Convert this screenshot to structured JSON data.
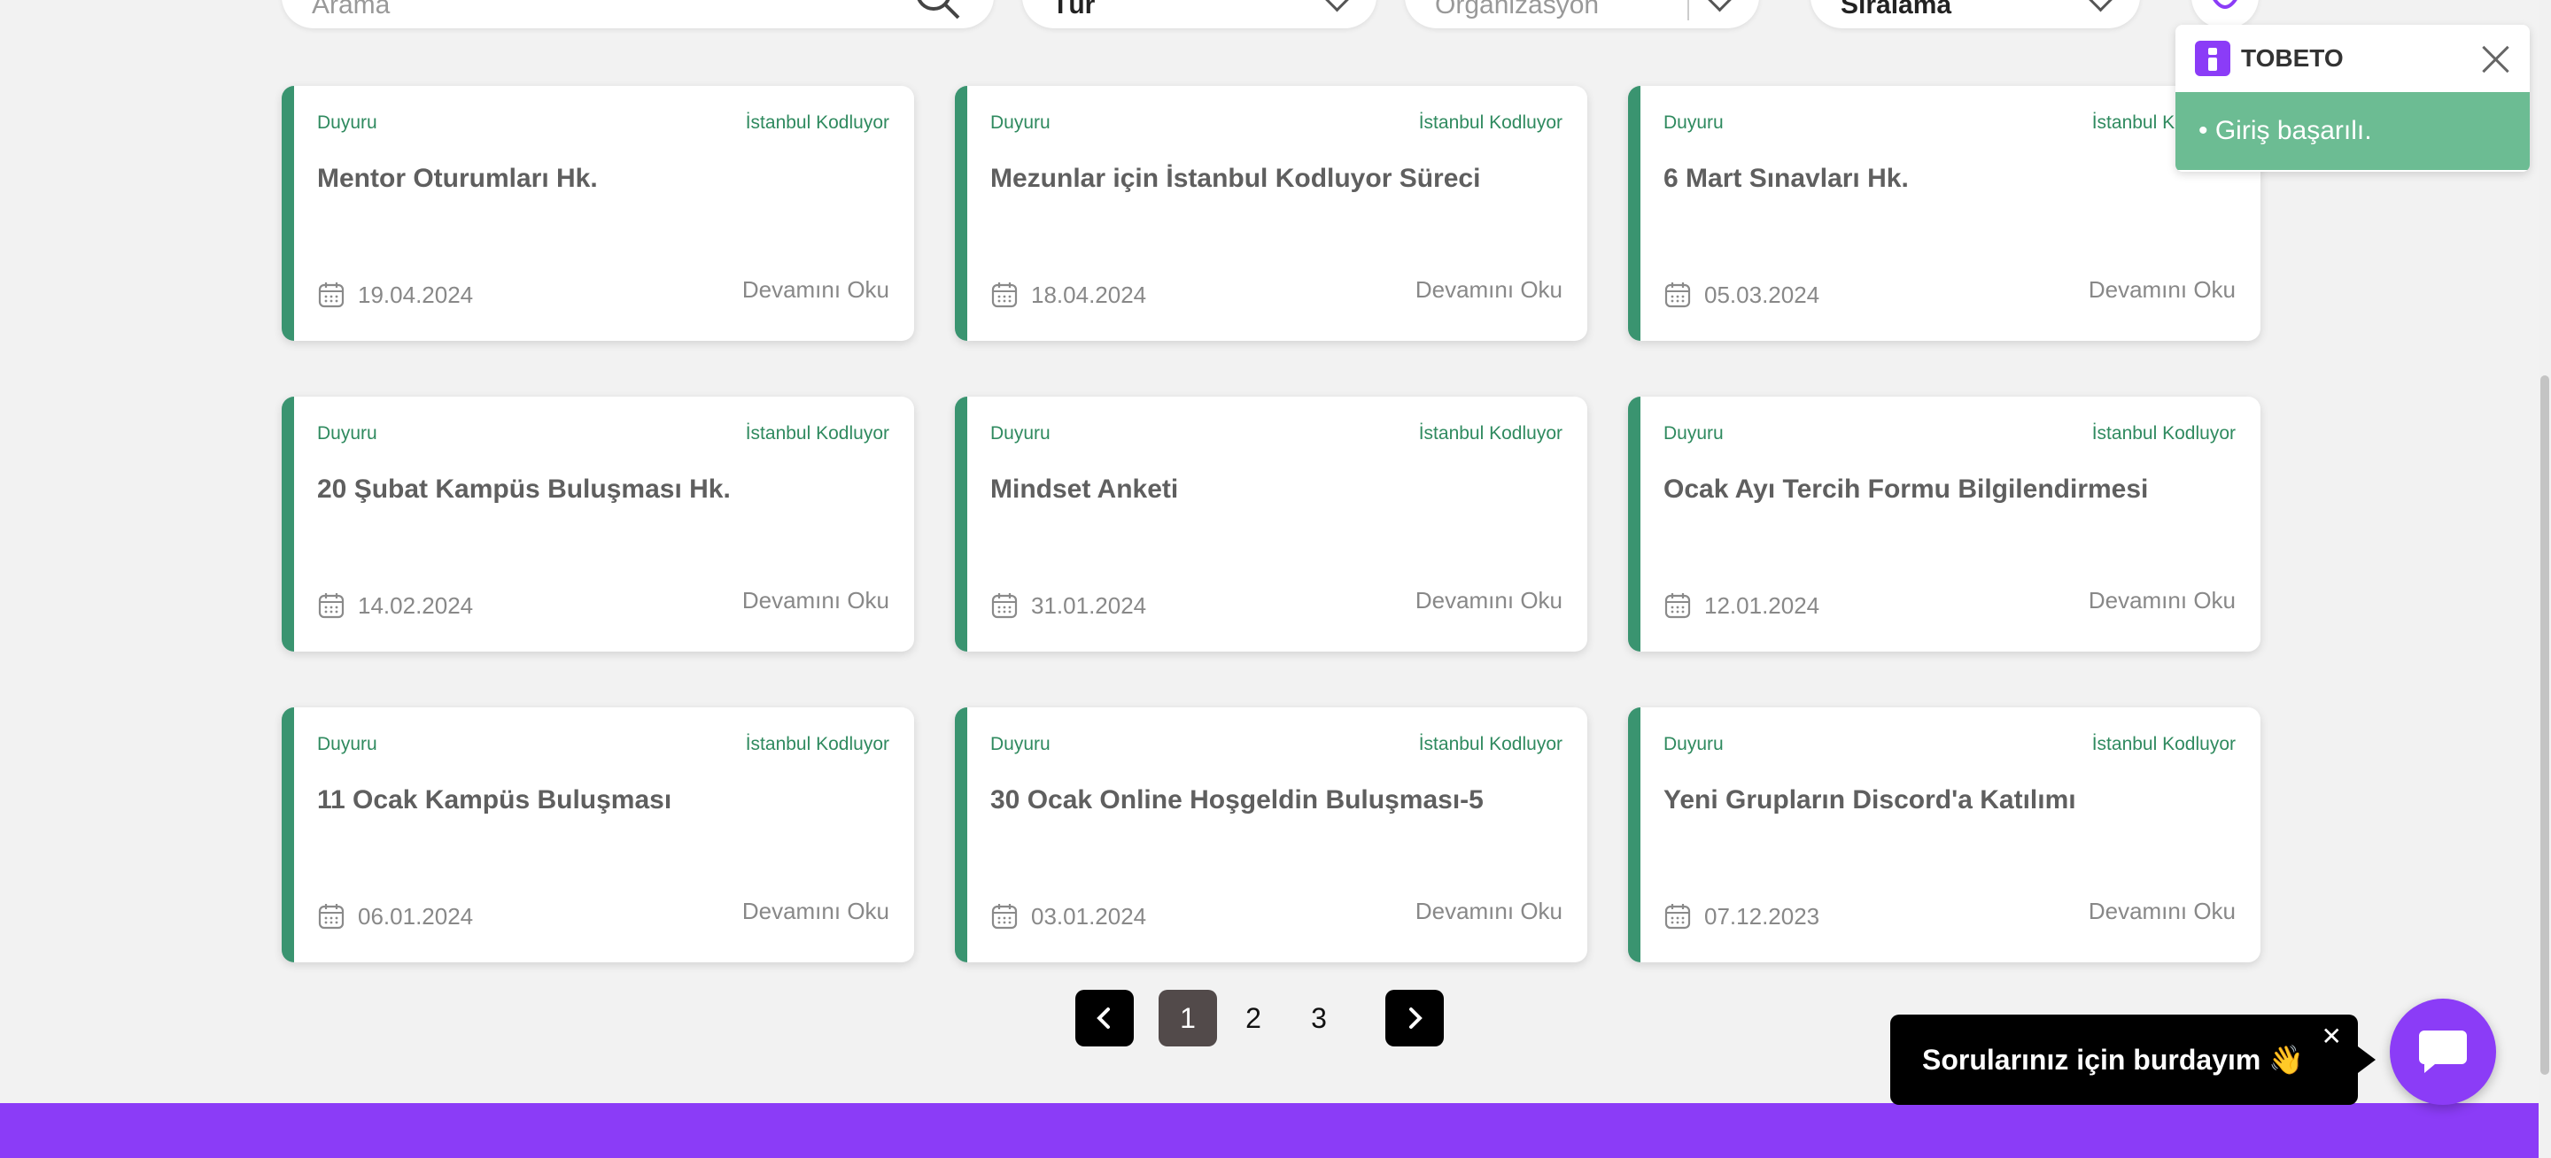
{
  "filters": {
    "search_placeholder": "Arama",
    "type_value": "Tür",
    "organization_placeholder": "Organizasyon",
    "sort_value": "Sıralama"
  },
  "cards": [
    {
      "category": "Duyuru",
      "org": "İstanbul Kodluyor",
      "title": "Mentor Oturumları Hk.",
      "date": "19.04.2024",
      "more": "Devamını Oku"
    },
    {
      "category": "Duyuru",
      "org": "İstanbul Kodluyor",
      "title": "Mezunlar için İstanbul Kodluyor Süreci",
      "date": "18.04.2024",
      "more": "Devamını Oku"
    },
    {
      "category": "Duyuru",
      "org": "İstanbul Kodluyor",
      "title": "6 Mart Sınavları Hk.",
      "date": "05.03.2024",
      "more": "Devamını Oku"
    },
    {
      "category": "Duyuru",
      "org": "İstanbul Kodluyor",
      "title": "20 Şubat Kampüs Buluşması Hk.",
      "date": "14.02.2024",
      "more": "Devamını Oku"
    },
    {
      "category": "Duyuru",
      "org": "İstanbul Kodluyor",
      "title": "Mindset Anketi",
      "date": "31.01.2024",
      "more": "Devamını Oku"
    },
    {
      "category": "Duyuru",
      "org": "İstanbul Kodluyor",
      "title": "Ocak Ayı Tercih Formu Bilgilendirmesi",
      "date": "12.01.2024",
      "more": "Devamını Oku"
    },
    {
      "category": "Duyuru",
      "org": "İstanbul Kodluyor",
      "title": "11 Ocak Kampüs Buluşması",
      "date": "06.01.2024",
      "more": "Devamını Oku"
    },
    {
      "category": "Duyuru",
      "org": "İstanbul Kodluyor",
      "title": "30 Ocak Online Hoşgeldin Buluşması-5",
      "date": "03.01.2024",
      "more": "Devamını Oku"
    },
    {
      "category": "Duyuru",
      "org": "İstanbul Kodluyor",
      "title": "Yeni Grupların Discord'a Katılımı",
      "date": "07.12.2023",
      "more": "Devamını Oku"
    }
  ],
  "pagination": {
    "pages": [
      "1",
      "2",
      "3"
    ],
    "current": "1"
  },
  "toast": {
    "brand": "TOBETO",
    "message": "• Giriş başarılı."
  },
  "chat": {
    "bubble_text": "Sorularınız için burdayım 👋",
    "close": "✕"
  },
  "colors": {
    "accent": "#8b3cf7",
    "card_border": "#3a9470",
    "toast_success": "#6cbc93"
  }
}
